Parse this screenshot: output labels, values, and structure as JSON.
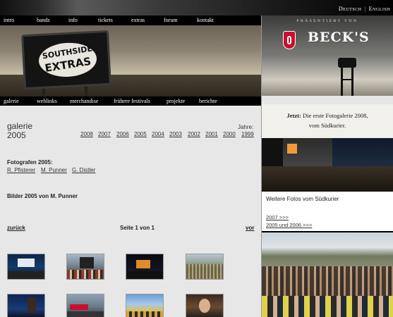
{
  "language_bar": {
    "deutsch": "Deutsch",
    "english": "English",
    "separator": "|"
  },
  "main_nav": [
    "intro",
    "bands",
    "info",
    "tickets",
    "extras",
    "forum",
    "kontakt"
  ],
  "header": {
    "sign_line1": "SOUTHSIDE",
    "sign_line2": "EXTRAS"
  },
  "sub_nav": [
    "galerie",
    "weblinks",
    "merchandise",
    "frühere festivals",
    "projekte",
    "berichte"
  ],
  "sponsor": {
    "presented_by": "PRÄSENTIERT VON",
    "brand": "BECK'S"
  },
  "content": {
    "title_line1": "galerie",
    "title_line2": "2005",
    "years_label": "Jahre:",
    "years": [
      "2008",
      "2007",
      "2006",
      "2005",
      "2004",
      "2003",
      "2002",
      "2001",
      "2000",
      "1999"
    ],
    "photographers_label": "Fotografen 2005:",
    "photographers": [
      "R. Pfisterer",
      "M. Punner",
      "G. Distler"
    ],
    "images_label": "Bilder 2005 von M. Punner",
    "back_label": "zurück",
    "page_indicator": "Seite 1 von 1",
    "next_label": "vor"
  },
  "promo": {
    "headline_highlight": "Jetzt:",
    "headline_rest": " Die erste Fotogalerie 2008,",
    "headline_line2": "vom Südkurier.",
    "more_photos": "Weitere Fotos vom Südkurier",
    "link_2007": "2007 >>>",
    "link_2005_2006": "2005 und 2006 >>>"
  },
  "colors": {
    "nav_bg": "#000000",
    "content_bg": "#e7e7e7",
    "becks_red": "#c8102e"
  }
}
